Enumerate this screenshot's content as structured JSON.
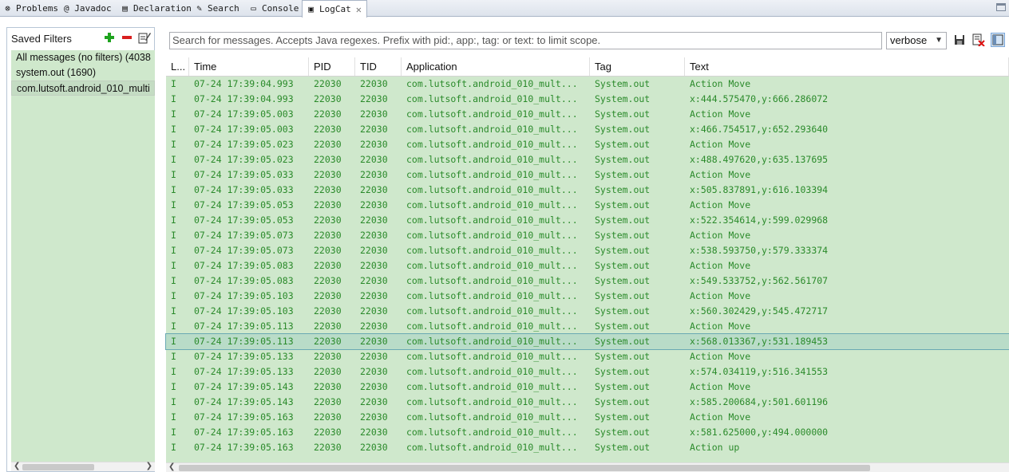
{
  "tabs": [
    {
      "label": "Problems",
      "icon": "problems-icon",
      "glyph": "⊗"
    },
    {
      "label": "@ Javadoc",
      "icon": "javadoc-icon",
      "glyph": ""
    },
    {
      "label": "Declaration",
      "icon": "declaration-icon",
      "glyph": "▤"
    },
    {
      "label": "Search",
      "icon": "search-icon",
      "glyph": "✎"
    },
    {
      "label": "Console",
      "icon": "console-icon",
      "glyph": "▭"
    },
    {
      "label": "LogCat",
      "icon": "logcat-icon",
      "glyph": "▣",
      "active": true
    }
  ],
  "close_glyph": "✕",
  "filters": {
    "title": "Saved Filters",
    "items": [
      {
        "label": "All messages (no filters) (4038",
        "selected": false
      },
      {
        "label": "system.out (1690)",
        "selected": false
      },
      {
        "label": "com.lutsoft.android_010_multi",
        "selected": true
      }
    ]
  },
  "search": {
    "placeholder": "Search for messages. Accepts Java regexes. Prefix with pid:, app:, tag: or text: to limit scope."
  },
  "log_level": {
    "selected": "verbose"
  },
  "table": {
    "columns": [
      "L...",
      "Time",
      "PID",
      "TID",
      "Application",
      "Tag",
      "Text"
    ],
    "rows": [
      [
        "I",
        "07-24 17:39:04.993",
        "22030",
        "22030",
        "com.lutsoft.android_010_mult...",
        "System.out",
        "Action Move"
      ],
      [
        "I",
        "07-24 17:39:04.993",
        "22030",
        "22030",
        "com.lutsoft.android_010_mult...",
        "System.out",
        "x:444.575470,y:666.286072"
      ],
      [
        "I",
        "07-24 17:39:05.003",
        "22030",
        "22030",
        "com.lutsoft.android_010_mult...",
        "System.out",
        "Action Move"
      ],
      [
        "I",
        "07-24 17:39:05.003",
        "22030",
        "22030",
        "com.lutsoft.android_010_mult...",
        "System.out",
        "x:466.754517,y:652.293640"
      ],
      [
        "I",
        "07-24 17:39:05.023",
        "22030",
        "22030",
        "com.lutsoft.android_010_mult...",
        "System.out",
        "Action Move"
      ],
      [
        "I",
        "07-24 17:39:05.023",
        "22030",
        "22030",
        "com.lutsoft.android_010_mult...",
        "System.out",
        "x:488.497620,y:635.137695"
      ],
      [
        "I",
        "07-24 17:39:05.033",
        "22030",
        "22030",
        "com.lutsoft.android_010_mult...",
        "System.out",
        "Action Move"
      ],
      [
        "I",
        "07-24 17:39:05.033",
        "22030",
        "22030",
        "com.lutsoft.android_010_mult...",
        "System.out",
        "x:505.837891,y:616.103394"
      ],
      [
        "I",
        "07-24 17:39:05.053",
        "22030",
        "22030",
        "com.lutsoft.android_010_mult...",
        "System.out",
        "Action Move"
      ],
      [
        "I",
        "07-24 17:39:05.053",
        "22030",
        "22030",
        "com.lutsoft.android_010_mult...",
        "System.out",
        "x:522.354614,y:599.029968"
      ],
      [
        "I",
        "07-24 17:39:05.073",
        "22030",
        "22030",
        "com.lutsoft.android_010_mult...",
        "System.out",
        "Action Move"
      ],
      [
        "I",
        "07-24 17:39:05.073",
        "22030",
        "22030",
        "com.lutsoft.android_010_mult...",
        "System.out",
        "x:538.593750,y:579.333374"
      ],
      [
        "I",
        "07-24 17:39:05.083",
        "22030",
        "22030",
        "com.lutsoft.android_010_mult...",
        "System.out",
        "Action Move"
      ],
      [
        "I",
        "07-24 17:39:05.083",
        "22030",
        "22030",
        "com.lutsoft.android_010_mult...",
        "System.out",
        "x:549.533752,y:562.561707"
      ],
      [
        "I",
        "07-24 17:39:05.103",
        "22030",
        "22030",
        "com.lutsoft.android_010_mult...",
        "System.out",
        "Action Move"
      ],
      [
        "I",
        "07-24 17:39:05.103",
        "22030",
        "22030",
        "com.lutsoft.android_010_mult...",
        "System.out",
        "x:560.302429,y:545.472717"
      ],
      [
        "I",
        "07-24 17:39:05.113",
        "22030",
        "22030",
        "com.lutsoft.android_010_mult...",
        "System.out",
        "Action Move"
      ],
      [
        "I",
        "07-24 17:39:05.113",
        "22030",
        "22030",
        "com.lutsoft.android_010_mult...",
        "System.out",
        "x:568.013367,y:531.189453"
      ],
      [
        "I",
        "07-24 17:39:05.133",
        "22030",
        "22030",
        "com.lutsoft.android_010_mult...",
        "System.out",
        "Action Move"
      ],
      [
        "I",
        "07-24 17:39:05.133",
        "22030",
        "22030",
        "com.lutsoft.android_010_mult...",
        "System.out",
        "x:574.034119,y:516.341553"
      ],
      [
        "I",
        "07-24 17:39:05.143",
        "22030",
        "22030",
        "com.lutsoft.android_010_mult...",
        "System.out",
        "Action Move"
      ],
      [
        "I",
        "07-24 17:39:05.143",
        "22030",
        "22030",
        "com.lutsoft.android_010_mult...",
        "System.out",
        "x:585.200684,y:501.601196"
      ],
      [
        "I",
        "07-24 17:39:05.163",
        "22030",
        "22030",
        "com.lutsoft.android_010_mult...",
        "System.out",
        "Action Move"
      ],
      [
        "I",
        "07-24 17:39:05.163",
        "22030",
        "22030",
        "com.lutsoft.android_010_mult...",
        "System.out",
        "x:581.625000,y:494.000000"
      ],
      [
        "I",
        "07-24 17:39:05.163",
        "22030",
        "22030",
        "com.lutsoft.android_010_mult...",
        "System.out",
        "Action up"
      ]
    ],
    "selected_row": 17
  },
  "colors": {
    "row_bg": "#cfe8cc",
    "row_text": "#2a8a2a",
    "selected_row_bg": "#b9dcc8"
  }
}
